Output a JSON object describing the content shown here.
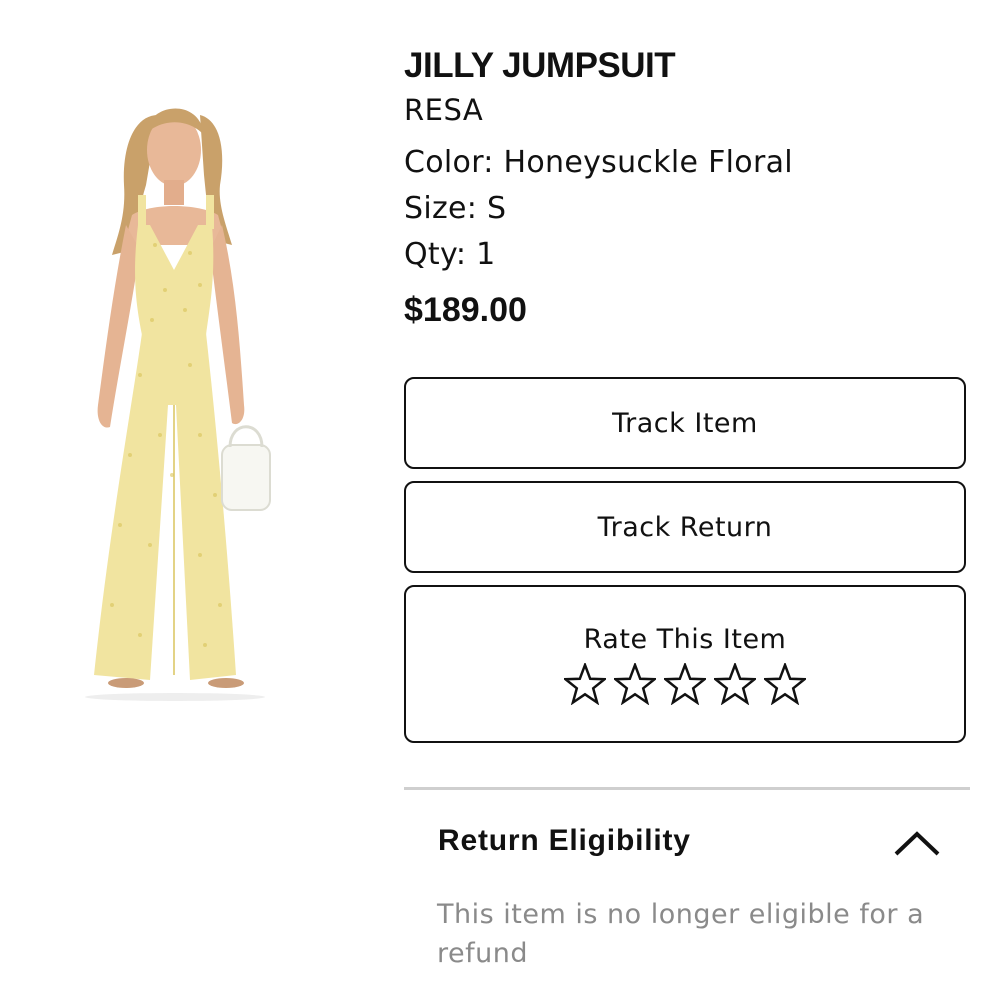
{
  "product": {
    "title": "JILLY JUMPSUIT",
    "brand": "RESA",
    "color": "Color: Honeysuckle Floral",
    "size": "Size: S",
    "qty": "Qty: 1",
    "price": "$189.00",
    "image_colors": {
      "garment": "#f1e4a0",
      "skin": "#e8b898",
      "hair": "#c9a16a"
    }
  },
  "actions": {
    "track_item": "Track Item",
    "track_return": "Track Return",
    "rate_label": "Rate This Item",
    "rating_max": 5,
    "rating_value": 0,
    "star_icon": "star-outline-icon"
  },
  "return_section": {
    "title": "Return Eligibility",
    "expanded": true,
    "chevron_icon": "chevron-up-icon",
    "message": "This item is no longer eligible for a refund"
  }
}
